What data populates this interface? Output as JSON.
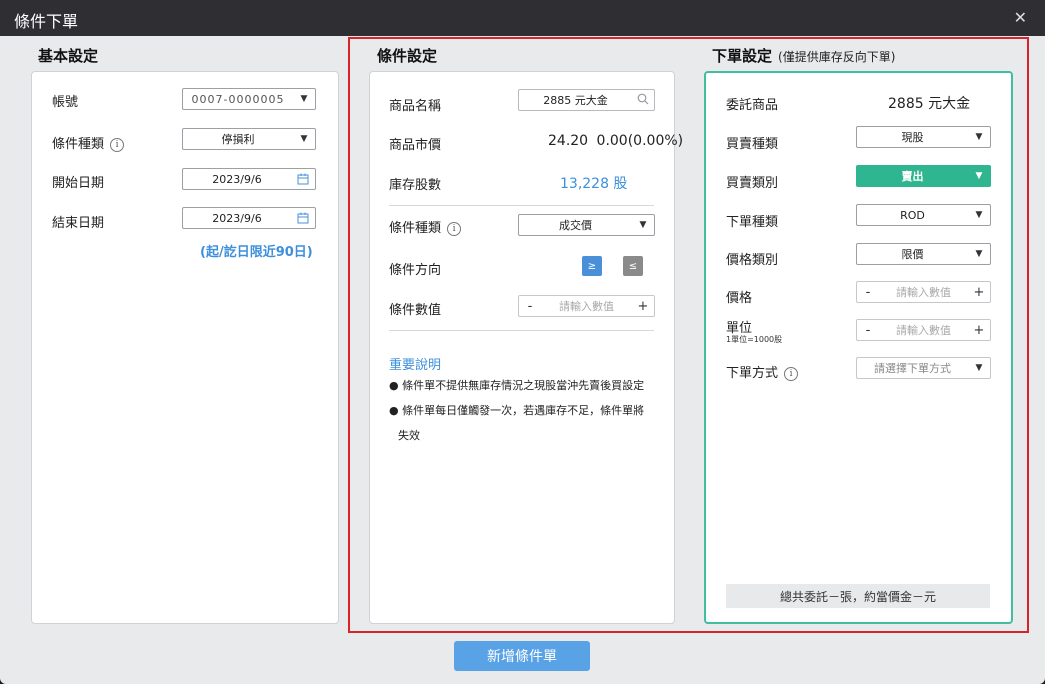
{
  "window": {
    "title": "條件下單",
    "close_glyph": "✕"
  },
  "basic": {
    "title": "基本設定",
    "account_label": "帳號",
    "account_value": "0007-0000005",
    "condition_type_label": "條件種類",
    "condition_type_value": "停損利",
    "start_date_label": "開始日期",
    "start_date_value": "2023/9/6",
    "end_date_label": "結束日期",
    "end_date_value": "2023/9/6",
    "range_note": "(起/訖日限近90日)"
  },
  "condition": {
    "title": "條件設定",
    "product_label": "商品名稱",
    "product_value": "2885 元大金",
    "market_price_label": "商品市價",
    "market_price_value": "24.20",
    "change_value": "0.00(0.00%)",
    "inventory_label": "庫存股數",
    "inventory_value": "13,228 股",
    "type_label": "條件種類",
    "type_value": "成交價",
    "direction_label": "條件方向",
    "dir_ge": "≥",
    "dir_le": "≤",
    "value_label": "條件數值",
    "value_placeholder": "請輸入數值",
    "notes_title": "重要說明",
    "note1": "● 條件單不提供無庫存情況之現股當沖先賣後買設定",
    "note2": "● 條件單每日僅觸發一次，若遇庫存不足，條件單將",
    "note3": "失效"
  },
  "order": {
    "title": "下單設定",
    "subtitle": "(僅提供庫存反向下單)",
    "product_label": "委託商品",
    "product_value": "2885 元大金",
    "trade_type_label": "買賣種類",
    "trade_type_value": "現股",
    "side_label": "買賣類別",
    "side_value": "賣出",
    "order_type_label": "下單種類",
    "order_type_value": "ROD",
    "price_type_label": "價格類別",
    "price_type_value": "限價",
    "price_label": "價格",
    "price_placeholder": "請輸入數值",
    "unit_label": "單位",
    "unit_sub": "1單位=1000股",
    "unit_placeholder": "請輸入數值",
    "method_label": "下單方式",
    "method_placeholder": "請選擇下單方式",
    "summary": "總共委託－張，約當價金－元"
  },
  "stepper": {
    "minus": "-",
    "plus": "+"
  },
  "submit_label": "新增條件單",
  "colors": {
    "accent_green": "#2fb58f",
    "accent_blue": "#4a90d9",
    "highlight_red": "#d9232a"
  },
  "icons": {
    "caret": "▼",
    "info": "i"
  }
}
